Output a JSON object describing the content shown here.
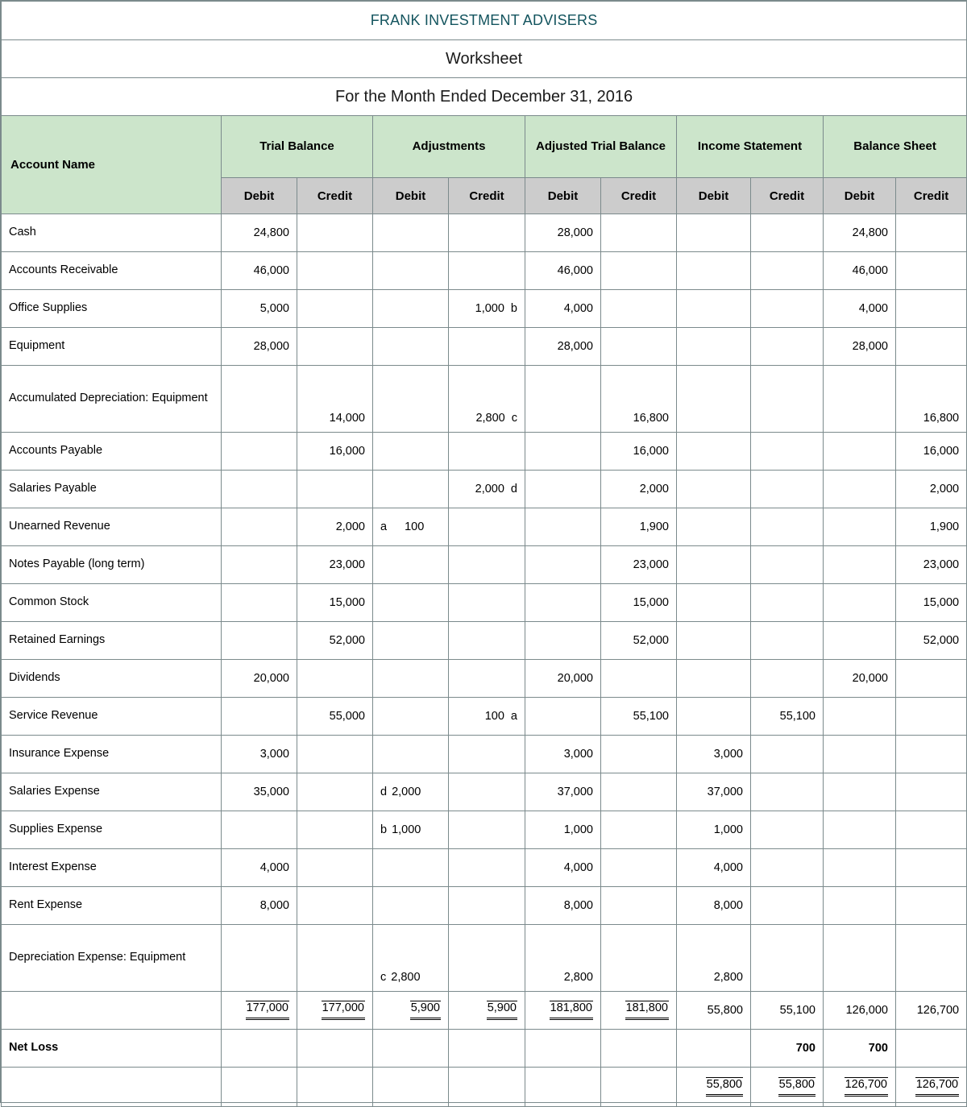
{
  "document": {
    "company": "FRANK INVESTMENT ADVISERS",
    "doc_type": "Worksheet",
    "period": "For the Month Ended December 31, 2016"
  },
  "colors": {
    "title_teal": "#13545e",
    "group_header_green": "#cce5cb",
    "subheader_gray": "#cccccc",
    "grid_line": "#7b8a8c"
  },
  "headers": {
    "account_name": "Account Name",
    "groups": [
      "Trial Balance",
      "Adjustments",
      "Adjusted Trial Balance",
      "Income Statement",
      "Balance Sheet"
    ],
    "debit": "Debit",
    "credit": "Credit",
    "dc_labels": [
      "Debit",
      "Credit",
      "Debit",
      "Credit",
      "Debit",
      "Credit",
      "Debit",
      "Credit",
      "Debit",
      "Credit"
    ]
  },
  "rows": [
    {
      "account": "Cash",
      "tb_debit": "24,800",
      "tb_credit": "",
      "adj_debit_letter": "",
      "adj_debit": "",
      "adj_credit": "",
      "adj_credit_letter": "",
      "atb_debit": "28,000",
      "atb_credit": "",
      "is_debit": "",
      "is_credit": "",
      "bs_debit": "24,800",
      "bs_credit": ""
    },
    {
      "account": "Accounts Receivable",
      "tb_debit": "46,000",
      "tb_credit": "",
      "adj_debit_letter": "",
      "adj_debit": "",
      "adj_credit": "",
      "adj_credit_letter": "",
      "atb_debit": "46,000",
      "atb_credit": "",
      "is_debit": "",
      "is_credit": "",
      "bs_debit": "46,000",
      "bs_credit": ""
    },
    {
      "account": "Office Supplies",
      "tb_debit": "5,000",
      "tb_credit": "",
      "adj_debit_letter": "",
      "adj_debit": "",
      "adj_credit": "1,000",
      "adj_credit_letter": "b",
      "atb_debit": "4,000",
      "atb_credit": "",
      "is_debit": "",
      "is_credit": "",
      "bs_debit": "4,000",
      "bs_credit": ""
    },
    {
      "account": "Equipment",
      "tb_debit": "28,000",
      "tb_credit": "",
      "adj_debit_letter": "",
      "adj_debit": "",
      "adj_credit": "",
      "adj_credit_letter": "",
      "atb_debit": "28,000",
      "atb_credit": "",
      "is_debit": "",
      "is_credit": "",
      "bs_debit": "28,000",
      "bs_credit": ""
    },
    {
      "account": "Accumulated Depreciation: Equipment",
      "tall": true,
      "tb_debit": "",
      "tb_credit": "14,000",
      "adj_debit_letter": "",
      "adj_debit": "",
      "adj_credit": "2,800",
      "adj_credit_letter": "c",
      "atb_debit": "",
      "atb_credit": "16,800",
      "is_debit": "",
      "is_credit": "",
      "bs_debit": "",
      "bs_credit": "16,800"
    },
    {
      "account": "Accounts Payable",
      "tb_debit": "",
      "tb_credit": "16,000",
      "adj_debit_letter": "",
      "adj_debit": "",
      "adj_credit": "",
      "adj_credit_letter": "",
      "atb_debit": "",
      "atb_credit": "16,000",
      "is_debit": "",
      "is_credit": "",
      "bs_debit": "",
      "bs_credit": "16,000"
    },
    {
      "account": "Salaries Payable",
      "tb_debit": "",
      "tb_credit": "",
      "adj_debit_letter": "",
      "adj_debit": "",
      "adj_credit": "2,000",
      "adj_credit_letter": "d",
      "atb_debit": "",
      "atb_credit": "2,000",
      "is_debit": "",
      "is_credit": "",
      "bs_debit": "",
      "bs_credit": "2,000"
    },
    {
      "account": "Unearned Revenue",
      "tb_debit": "",
      "tb_credit": "2,000",
      "adj_debit_letter": "a",
      "adj_debit": "100",
      "adj_debit_spaced": true,
      "adj_credit": "",
      "adj_credit_letter": "",
      "atb_debit": "",
      "atb_credit": "1,900",
      "is_debit": "",
      "is_credit": "",
      "bs_debit": "",
      "bs_credit": "1,900"
    },
    {
      "account": "Notes Payable (long term)",
      "tb_debit": "",
      "tb_credit": "23,000",
      "adj_debit_letter": "",
      "adj_debit": "",
      "adj_credit": "",
      "adj_credit_letter": "",
      "atb_debit": "",
      "atb_credit": "23,000",
      "is_debit": "",
      "is_credit": "",
      "bs_debit": "",
      "bs_credit": "23,000"
    },
    {
      "account": "Common Stock",
      "tb_debit": "",
      "tb_credit": "15,000",
      "adj_debit_letter": "",
      "adj_debit": "",
      "adj_credit": "",
      "adj_credit_letter": "",
      "atb_debit": "",
      "atb_credit": "15,000",
      "is_debit": "",
      "is_credit": "",
      "bs_debit": "",
      "bs_credit": "15,000"
    },
    {
      "account": "Retained Earnings",
      "tb_debit": "",
      "tb_credit": "52,000",
      "adj_debit_letter": "",
      "adj_debit": "",
      "adj_credit": "",
      "adj_credit_letter": "",
      "atb_debit": "",
      "atb_credit": "52,000",
      "is_debit": "",
      "is_credit": "",
      "bs_debit": "",
      "bs_credit": "52,000"
    },
    {
      "account": "Dividends",
      "tb_debit": "20,000",
      "tb_credit": "",
      "adj_debit_letter": "",
      "adj_debit": "",
      "adj_credit": "",
      "adj_credit_letter": "",
      "atb_debit": "20,000",
      "atb_credit": "",
      "is_debit": "",
      "is_credit": "",
      "bs_debit": "20,000",
      "bs_credit": ""
    },
    {
      "account": "Service Revenue",
      "tb_debit": "",
      "tb_credit": "55,000",
      "adj_debit_letter": "",
      "adj_debit": "",
      "adj_credit": "100",
      "adj_credit_letter": "a",
      "atb_debit": "",
      "atb_credit": "55,100",
      "is_debit": "",
      "is_credit": "55,100",
      "bs_debit": "",
      "bs_credit": ""
    },
    {
      "account": "Insurance Expense",
      "tb_debit": "3,000",
      "tb_credit": "",
      "adj_debit_letter": "",
      "adj_debit": "",
      "adj_credit": "",
      "adj_credit_letter": "",
      "atb_debit": "3,000",
      "atb_credit": "",
      "is_debit": "3,000",
      "is_credit": "",
      "bs_debit": "",
      "bs_credit": ""
    },
    {
      "account": "Salaries Expense",
      "tb_debit": "35,000",
      "tb_credit": "",
      "adj_debit_letter": "d",
      "adj_debit": "2,000",
      "adj_credit": "",
      "adj_credit_letter": "",
      "atb_debit": "37,000",
      "atb_credit": "",
      "is_debit": "37,000",
      "is_credit": "",
      "bs_debit": "",
      "bs_credit": ""
    },
    {
      "account": "Supplies Expense",
      "tb_debit": "",
      "tb_credit": "",
      "adj_debit_letter": "b",
      "adj_debit": "1,000",
      "adj_credit": "",
      "adj_credit_letter": "",
      "atb_debit": "1,000",
      "atb_credit": "",
      "is_debit": "1,000",
      "is_credit": "",
      "bs_debit": "",
      "bs_credit": ""
    },
    {
      "account": "Interest Expense",
      "tb_debit": "4,000",
      "tb_credit": "",
      "adj_debit_letter": "",
      "adj_debit": "",
      "adj_credit": "",
      "adj_credit_letter": "",
      "atb_debit": "4,000",
      "atb_credit": "",
      "is_debit": "4,000",
      "is_credit": "",
      "bs_debit": "",
      "bs_credit": ""
    },
    {
      "account": "Rent Expense",
      "tb_debit": "8,000",
      "tb_credit": "",
      "adj_debit_letter": "",
      "adj_debit": "",
      "adj_credit": "",
      "adj_credit_letter": "",
      "atb_debit": "8,000",
      "atb_credit": "",
      "is_debit": "8,000",
      "is_credit": "",
      "bs_debit": "",
      "bs_credit": ""
    },
    {
      "account": "Depreciation Expense: Equipment",
      "tall": true,
      "tb_debit": "",
      "tb_credit": "",
      "adj_debit_letter": "c",
      "adj_debit": "2,800",
      "adj_credit": "",
      "adj_credit_letter": "",
      "atb_debit": "2,800",
      "atb_credit": "",
      "is_debit": "2,800",
      "is_credit": "",
      "bs_debit": "",
      "bs_credit": ""
    }
  ],
  "totals": {
    "account": "",
    "tb_debit": "177,000",
    "tb_credit": "177,000",
    "adj_debit": "5,900",
    "adj_credit": "5,900",
    "atb_debit": "181,800",
    "atb_credit": "181,800",
    "is_debit": "55,800",
    "is_credit": "55,100",
    "bs_debit": "126,000",
    "bs_credit": "126,700"
  },
  "net_loss": {
    "label": "Net Loss",
    "is_debit": "",
    "is_credit": "700",
    "bs_debit": "700",
    "bs_credit": ""
  },
  "final_totals": {
    "is_debit": "55,800",
    "is_credit": "55,800",
    "bs_debit": "126,700",
    "bs_credit": "126,700"
  }
}
